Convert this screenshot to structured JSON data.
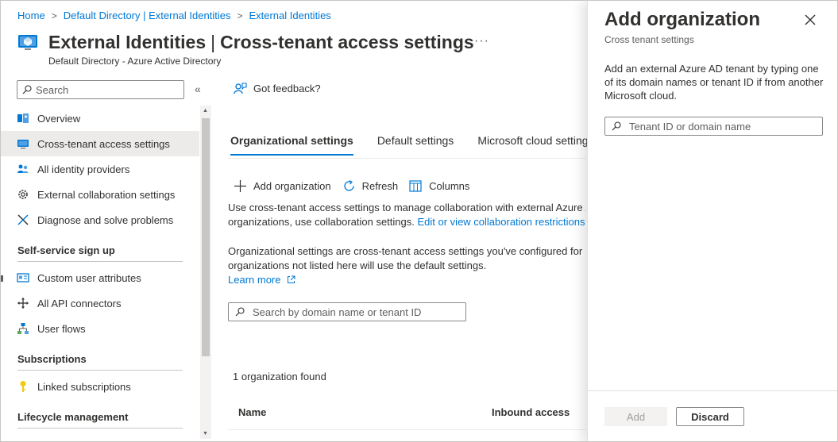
{
  "breadcrumb": {
    "items": [
      "Home",
      "Default Directory | External Identities",
      "External Identities"
    ]
  },
  "header": {
    "title_main": "External Identities",
    "title_divider": "|",
    "title_section": "Cross-tenant access settings",
    "subtitle": "Default Directory - Azure Active Directory",
    "more": "···"
  },
  "sidebar": {
    "search_placeholder": "Search",
    "collapse": "«",
    "items": [
      {
        "label": "Overview",
        "icon": "overview-icon"
      },
      {
        "label": "Cross-tenant access settings",
        "icon": "globe-network-icon"
      },
      {
        "label": "All identity providers",
        "icon": "users-icon"
      },
      {
        "label": "External collaboration settings",
        "icon": "gear-icon"
      },
      {
        "label": "Diagnose and solve problems",
        "icon": "wrench-icon"
      }
    ],
    "sections": [
      {
        "title": "Self-service sign up",
        "items": [
          {
            "label": "Custom user attributes",
            "icon": "id-card-icon"
          },
          {
            "label": "All API connectors",
            "icon": "move-arrows-icon"
          },
          {
            "label": "User flows",
            "icon": "flow-icon"
          }
        ]
      },
      {
        "title": "Subscriptions",
        "items": [
          {
            "label": "Linked subscriptions",
            "icon": "key-icon"
          }
        ]
      },
      {
        "title": "Lifecycle management",
        "items": []
      }
    ]
  },
  "main": {
    "feedback": "Got feedback?",
    "tabs": [
      "Organizational settings",
      "Default settings",
      "Microsoft cloud settings"
    ],
    "commands": {
      "add": "Add organization",
      "refresh": "Refresh",
      "columns": "Columns"
    },
    "desc1_line1": "Use cross-tenant access settings to manage collaboration with external Azure AD",
    "desc1_line2": "organizations, use collaboration settings.",
    "desc1_link": "Edit or view collaboration restrictions",
    "desc2_line1": "Organizational settings are cross-tenant access settings you've configured for specific",
    "desc2_line2": "organizations not listed here will use the default settings.",
    "learn_more": "Learn more",
    "filter_placeholder": "Search by domain name or tenant ID",
    "count": "1 organization found",
    "columns": [
      "Name",
      "Inbound access"
    ]
  },
  "panel": {
    "title": "Add organization",
    "subtitle": "Cross tenant settings",
    "description": "Add an external Azure AD tenant by typing one of its domain names or tenant ID if from another Microsoft cloud.",
    "input_placeholder": "Tenant ID or domain name",
    "add_button": "Add",
    "discard_button": "Discard"
  },
  "colors": {
    "accent": "#0078d4",
    "text": "#323130",
    "muted": "#605e5c",
    "active_bg": "#edebe9"
  }
}
